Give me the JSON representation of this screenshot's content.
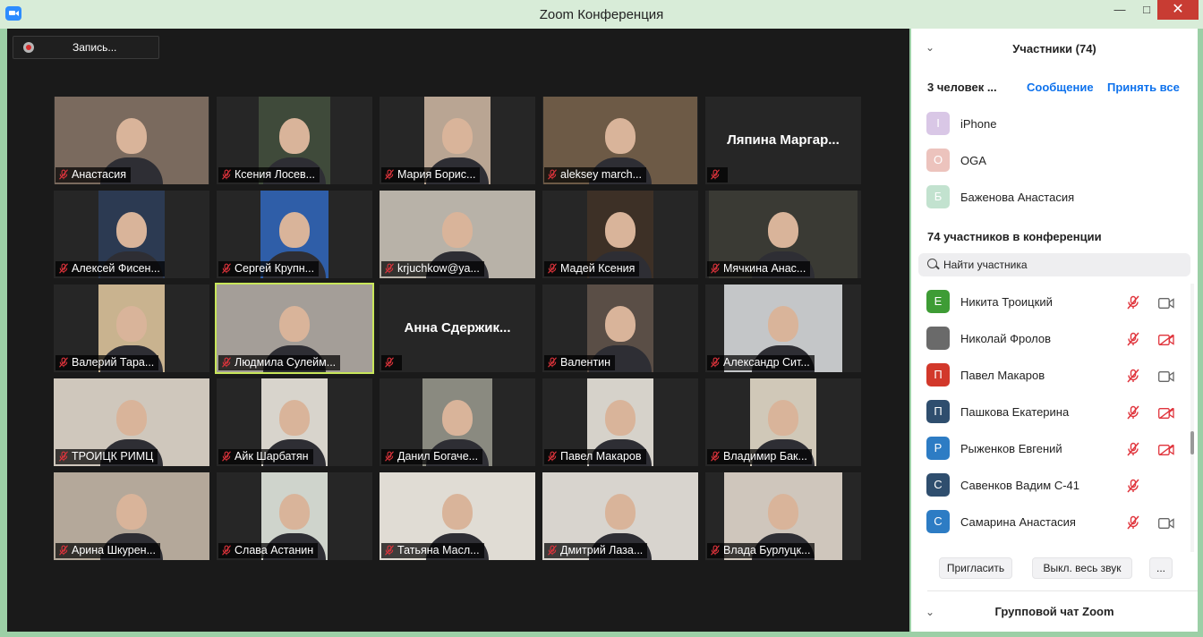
{
  "window": {
    "title": "Zoom Конференция",
    "minimize": "—",
    "maximize": "□",
    "close": "✕"
  },
  "recording": {
    "label": "Запись..."
  },
  "tiles": [
    {
      "name": "Анастасия",
      "bg": "#7a6a5e",
      "video": true
    },
    {
      "name": "Ксения Лосев...",
      "bg": "#3f4a3a",
      "video": true
    },
    {
      "name": "Мария Борис...",
      "bg": "#b9a593",
      "video": true
    },
    {
      "name": "aleksey march...",
      "bg": "#6d5a46",
      "video": true
    },
    {
      "name": "Ляпина  Маргар...",
      "bg": "#262626",
      "video": false
    },
    {
      "name": "Алексей Фисен...",
      "bg": "#2c3a52",
      "video": true
    },
    {
      "name": "Сергей Крупн...",
      "bg": "#2f5ea8",
      "video": true
    },
    {
      "name": "krjuchkow@ya...",
      "bg": "#b8b2a8",
      "video": true
    },
    {
      "name": "Мадей Ксения",
      "bg": "#3d3026",
      "video": true
    },
    {
      "name": "Мячкина Анас...",
      "bg": "#3a3a34",
      "video": true
    },
    {
      "name": "Валерий Тара...",
      "bg": "#c9b38f",
      "video": true
    },
    {
      "name": "Людмила Сулейм...",
      "bg": "#a49e98",
      "video": true,
      "active": true
    },
    {
      "name": "Анна  Сдержик...",
      "bg": "#262626",
      "video": false
    },
    {
      "name": "Валентин",
      "bg": "#5a4e46",
      "video": true
    },
    {
      "name": "Александр Сит...",
      "bg": "#c4c6c8",
      "video": true
    },
    {
      "name": "ТРОИЦК РИМЦ",
      "bg": "#cfc7bc",
      "video": true
    },
    {
      "name": "Айк Шарбатян",
      "bg": "#d8d4cc",
      "video": true
    },
    {
      "name": "Данил Богаче...",
      "bg": "#8a8a80",
      "video": true
    },
    {
      "name": "Павел Макаров",
      "bg": "#d6d2ca",
      "video": true
    },
    {
      "name": "Владимир Бак...",
      "bg": "#d0c8b8",
      "video": true
    },
    {
      "name": "Арина Шкурен...",
      "bg": "#b4a89a",
      "video": true
    },
    {
      "name": "Слава Астанин",
      "bg": "#cfd4cc",
      "video": true
    },
    {
      "name": "Татьяна Масл...",
      "bg": "#e0dcd4",
      "video": true
    },
    {
      "name": "Дмитрий Лаза...",
      "bg": "#d8d4ce",
      "video": true
    },
    {
      "name": "Влада Бурлуцк...",
      "bg": "#cfc6bc",
      "video": true
    }
  ],
  "panel": {
    "title": "Участники (74)",
    "waiting_label": "3 человек ...",
    "message_link": "Сообщение",
    "accept_all_link": "Принять все",
    "waiting": [
      {
        "initial": "I",
        "name": "iPhone",
        "color": "#d9c7e6"
      },
      {
        "initial": "O",
        "name": "OGA",
        "color": "#ecc3bd"
      },
      {
        "initial": "Б",
        "name": "Баженова Анастасия",
        "color": "#c2e2cf"
      }
    ],
    "in_meeting_label": "74 участников в конференции",
    "search_placeholder": "Найти участника",
    "participants": [
      {
        "initial": "Е",
        "name": "Никита Троицкий",
        "color": "#3e9c35",
        "muted": true,
        "video": "on"
      },
      {
        "initial": "",
        "name": "Николай Фролов",
        "color": "#6a6a6a",
        "muted": true,
        "video": "off"
      },
      {
        "initial": "П",
        "name": "Павел Макаров",
        "color": "#d2382b",
        "muted": true,
        "video": "on"
      },
      {
        "initial": "П",
        "name": "Пашкова Екатерина",
        "color": "#2f4e6e",
        "muted": true,
        "video": "off"
      },
      {
        "initial": "Р",
        "name": "Рыженков Евгений",
        "color": "#2d7cc4",
        "muted": true,
        "video": "off"
      },
      {
        "initial": "С",
        "name": "Савенков Вадим С-41",
        "color": "#2f4e6e",
        "muted": true,
        "video": "none"
      },
      {
        "initial": "С",
        "name": "Самарина Анастасия",
        "color": "#2d7cc4",
        "muted": true,
        "video": "on"
      }
    ],
    "invite_button": "Пригласить",
    "mute_all_button": "Выкл. весь звук",
    "more_button": "...",
    "chat_title": "Групповой чат Zoom"
  },
  "colors": {
    "mute_red": "#e0343c",
    "link_blue": "#0e72ed",
    "active_border": "#c8e65a"
  }
}
